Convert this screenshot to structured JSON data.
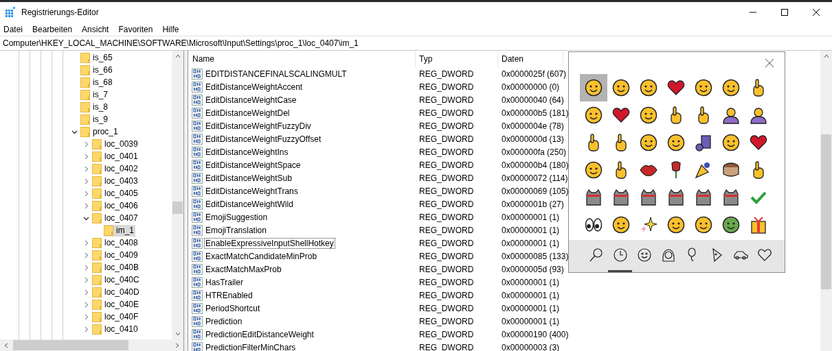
{
  "window": {
    "title": "Registrierungs-Editor"
  },
  "menu": [
    "Datei",
    "Bearbeiten",
    "Ansicht",
    "Favoriten",
    "Hilfe"
  ],
  "address": "Computer\\HKEY_LOCAL_MACHINE\\SOFTWARE\\Microsoft\\Input\\Settings\\proc_1\\loc_0407\\im_1",
  "tree": [
    {
      "label": "is_65",
      "selected": false
    },
    {
      "label": "is_66",
      "selected": false
    },
    {
      "label": "is_68",
      "selected": false
    },
    {
      "label": "is_7",
      "selected": false
    },
    {
      "label": "is_8",
      "selected": false
    },
    {
      "label": "is_9",
      "selected": false
    },
    {
      "label": "proc_1",
      "selected": false,
      "expanded": true,
      "children": [
        {
          "label": "loc_0039",
          "selected": false,
          "expanded": false
        },
        {
          "label": "loc_0401",
          "selected": false,
          "expanded": false
        },
        {
          "label": "loc_0402",
          "selected": false,
          "expanded": false
        },
        {
          "label": "loc_0403",
          "selected": false,
          "expanded": false
        },
        {
          "label": "loc_0405",
          "selected": false,
          "expanded": false
        },
        {
          "label": "loc_0406",
          "selected": false,
          "expanded": false
        },
        {
          "label": "loc_0407",
          "selected": false,
          "expanded": true,
          "children": [
            {
              "label": "im_1",
              "selected": true
            }
          ]
        },
        {
          "label": "loc_0408",
          "selected": false,
          "expanded": false
        },
        {
          "label": "loc_0409",
          "selected": false,
          "expanded": false
        },
        {
          "label": "loc_040B",
          "selected": false,
          "expanded": false
        },
        {
          "label": "loc_040C",
          "selected": false,
          "expanded": false
        },
        {
          "label": "loc_040D",
          "selected": false,
          "expanded": false
        },
        {
          "label": "loc_040E",
          "selected": false,
          "expanded": false
        },
        {
          "label": "loc_040F",
          "selected": false,
          "expanded": false
        },
        {
          "label": "loc_0410",
          "selected": false,
          "expanded": false
        }
      ]
    }
  ],
  "table": {
    "columns": [
      "Name",
      "Typ",
      "Daten"
    ],
    "rows": [
      {
        "name": "EDITDISTANCEFINALSCALINGMULT",
        "type": "REG_DWORD",
        "data": "0x0000025f (607)",
        "focused": false
      },
      {
        "name": "EditDistanceWeightAccent",
        "type": "REG_DWORD",
        "data": "0x00000000 (0)",
        "focused": false
      },
      {
        "name": "EditDistanceWeightCase",
        "type": "REG_DWORD",
        "data": "0x00000040 (64)",
        "focused": false
      },
      {
        "name": "EditDistanceWeightDel",
        "type": "REG_DWORD",
        "data": "0x000000b5 (181)",
        "focused": false
      },
      {
        "name": "EditDistanceWeightFuzzyDiv",
        "type": "REG_DWORD",
        "data": "0x0000004e (78)",
        "focused": false
      },
      {
        "name": "EditDistanceWeightFuzzyOffset",
        "type": "REG_DWORD",
        "data": "0x0000000d (13)",
        "focused": false
      },
      {
        "name": "EditDistanceWeightIns",
        "type": "REG_DWORD",
        "data": "0x000000fa (250)",
        "focused": false
      },
      {
        "name": "EditDistanceWeightSpace",
        "type": "REG_DWORD",
        "data": "0x000000b4 (180)",
        "focused": false
      },
      {
        "name": "EditDistanceWeightSub",
        "type": "REG_DWORD",
        "data": "0x00000072 (114)",
        "focused": false
      },
      {
        "name": "EditDistanceWeightTrans",
        "type": "REG_DWORD",
        "data": "0x00000069 (105)",
        "focused": false
      },
      {
        "name": "EditDistanceWeightWild",
        "type": "REG_DWORD",
        "data": "0x0000001b (27)",
        "focused": false
      },
      {
        "name": "EmojiSuggestion",
        "type": "REG_DWORD",
        "data": "0x00000001 (1)",
        "focused": false
      },
      {
        "name": "EmojiTranslation",
        "type": "REG_DWORD",
        "data": "0x00000001 (1)",
        "focused": false
      },
      {
        "name": "EnableExpressiveInputShellHotkey",
        "type": "REG_DWORD",
        "data": "0x00000001 (1)",
        "focused": true
      },
      {
        "name": "ExactMatchCandidateMinProb",
        "type": "REG_DWORD",
        "data": "0x00000085 (133)",
        "focused": false
      },
      {
        "name": "ExactMatchMaxProb",
        "type": "REG_DWORD",
        "data": "0x0000005d (93)",
        "focused": false
      },
      {
        "name": "HasTrailer",
        "type": "REG_DWORD",
        "data": "0x00000001 (1)",
        "focused": false
      },
      {
        "name": "HTREnabled",
        "type": "REG_DWORD",
        "data": "0x00000001 (1)",
        "focused": false
      },
      {
        "name": "PeriodShortcut",
        "type": "REG_DWORD",
        "data": "0x00000001 (1)",
        "focused": false
      },
      {
        "name": "Prediction",
        "type": "REG_DWORD",
        "data": "0x00000001 (1)",
        "focused": false
      },
      {
        "name": "PredictionEditDistanceWeight",
        "type": "REG_DWORD",
        "data": "0x00000190 (400)",
        "focused": false
      },
      {
        "name": "PredictionFilterMinChars",
        "type": "REG_DWORD",
        "data": "0x00000003 (3)",
        "focused": false
      }
    ]
  },
  "emoji_panel": {
    "emojis": [
      {
        "selected": true
      },
      {
        "selected": false
      },
      {
        "selected": false
      },
      {
        "selected": false
      },
      {
        "selected": false
      },
      {
        "selected": false
      },
      {
        "selected": false
      },
      {
        "selected": false
      },
      {
        "selected": false
      },
      {
        "selected": false
      },
      {
        "selected": false
      },
      {
        "selected": false
      },
      {
        "selected": false
      },
      {
        "selected": false
      },
      {
        "selected": false
      },
      {
        "selected": false
      },
      {
        "selected": false
      },
      {
        "selected": false
      },
      {
        "selected": false
      },
      {
        "selected": false
      },
      {
        "selected": false
      },
      {
        "selected": false
      },
      {
        "selected": false
      },
      {
        "selected": false
      },
      {
        "selected": false
      },
      {
        "selected": false
      },
      {
        "selected": false
      },
      {
        "selected": false
      },
      {
        "selected": false
      },
      {
        "selected": false
      },
      {
        "selected": false
      },
      {
        "selected": false
      },
      {
        "selected": false
      },
      {
        "selected": false
      },
      {
        "selected": false
      },
      {
        "selected": false
      },
      {
        "selected": false
      },
      {
        "selected": false
      },
      {
        "selected": false
      },
      {
        "selected": false
      },
      {
        "selected": false
      },
      {
        "selected": false
      }
    ],
    "categories": [
      {
        "selected": false
      },
      {
        "selected": true
      },
      {
        "selected": false
      },
      {
        "selected": false
      },
      {
        "selected": false
      },
      {
        "selected": false
      },
      {
        "selected": false
      },
      {
        "selected": false
      }
    ]
  }
}
